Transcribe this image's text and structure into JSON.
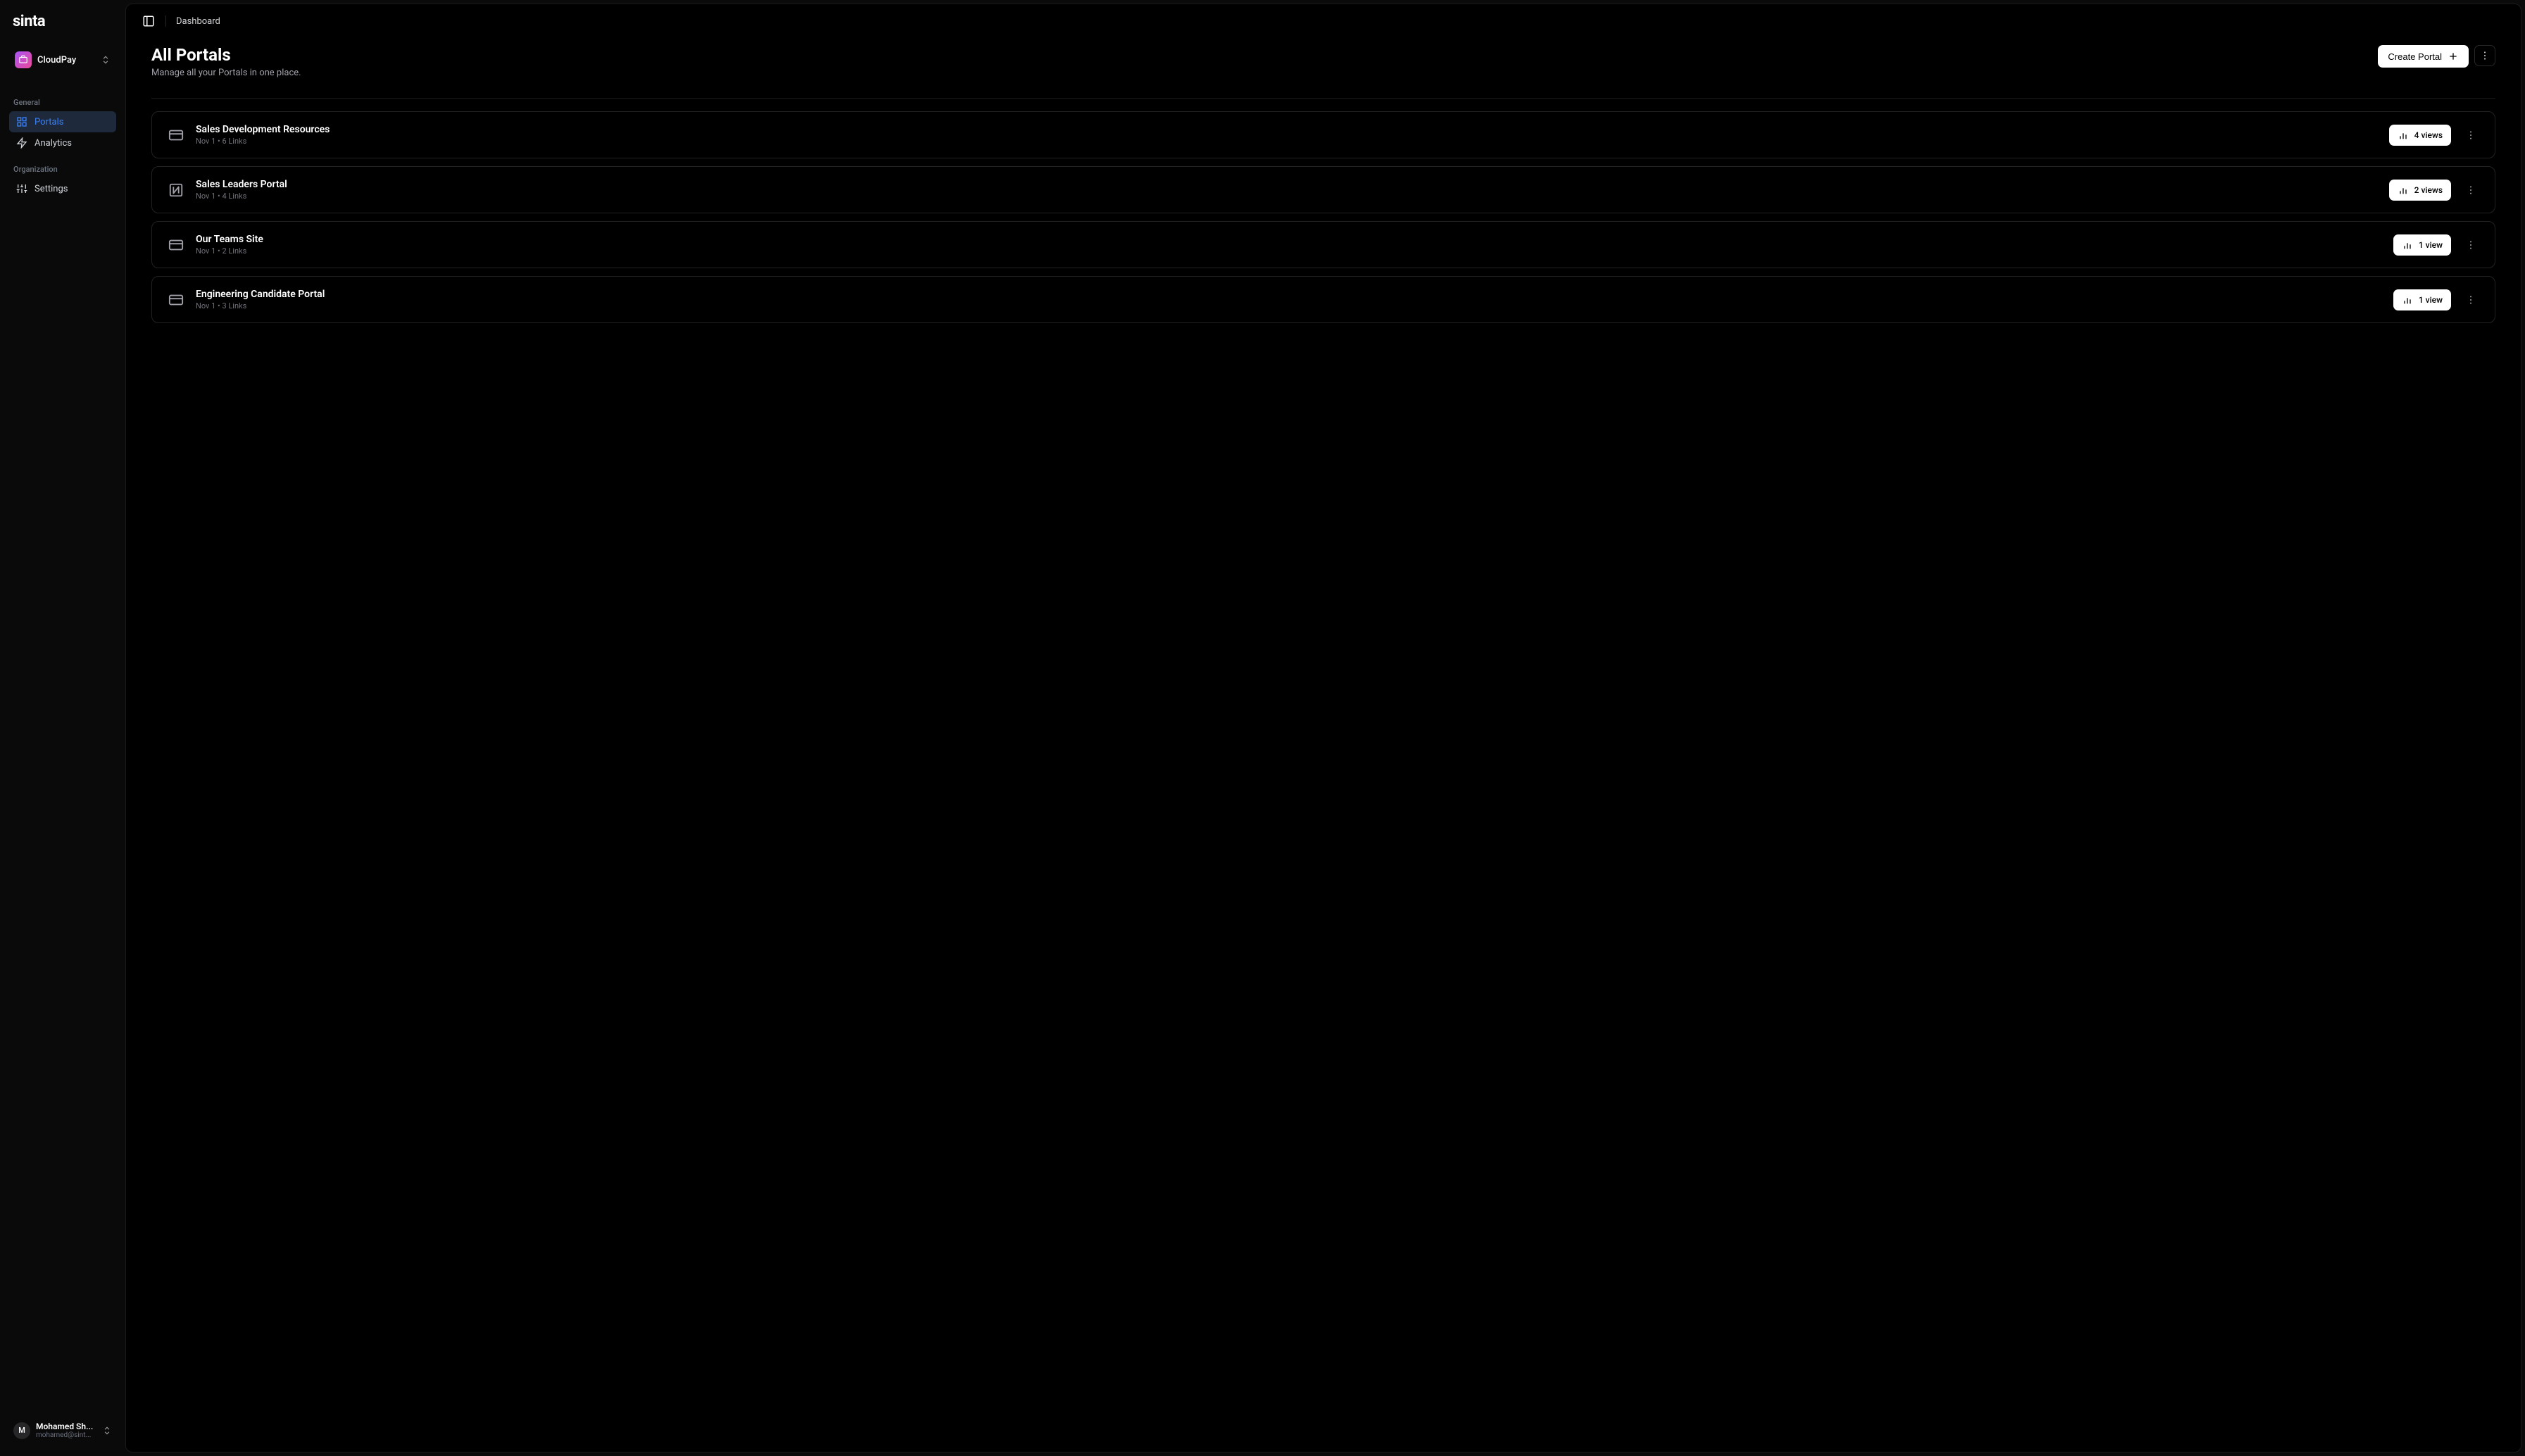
{
  "logo": "sinta",
  "workspace": {
    "name": "CloudPay"
  },
  "nav": {
    "sections": [
      {
        "label": "General",
        "items": [
          {
            "label": "Portals",
            "icon": "portals",
            "active": true
          },
          {
            "label": "Analytics",
            "icon": "analytics",
            "active": false
          }
        ]
      },
      {
        "label": "Organization",
        "items": [
          {
            "label": "Settings",
            "icon": "settings",
            "active": false
          }
        ]
      }
    ]
  },
  "user": {
    "initial": "M",
    "name": "Mohamed Sh...",
    "email": "mohamed@sint..."
  },
  "breadcrumb": "Dashboard",
  "page": {
    "title": "All Portals",
    "subtitle": "Manage all your Portals in one place.",
    "create_button": "Create Portal"
  },
  "portals": [
    {
      "title": "Sales Development Resources",
      "meta": "Nov 1 • 6 Links",
      "views": "4 views",
      "icon": "card"
    },
    {
      "title": "Sales Leaders Portal",
      "meta": "Nov 1 • 4 Links",
      "views": "2 views",
      "icon": "notion"
    },
    {
      "title": "Our Teams Site",
      "meta": "Nov 1 • 2 Links",
      "views": "1 view",
      "icon": "card"
    },
    {
      "title": "Engineering Candidate Portal",
      "meta": "Nov 1 • 3 Links",
      "views": "1 view",
      "icon": "card"
    }
  ]
}
